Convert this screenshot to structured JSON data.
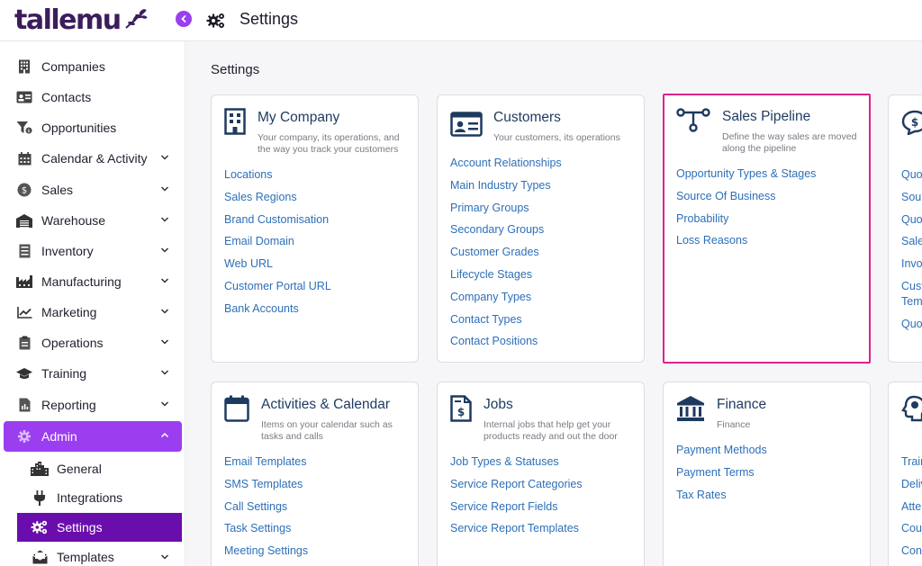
{
  "app": {
    "logo_text": "tallemu",
    "page_title": "Settings"
  },
  "colors": {
    "accent": "#9b3ef0",
    "active_sub": "#6a0dad",
    "link": "#2d6fb8",
    "highlight": "#e0218a",
    "title": "#1e3a5f"
  },
  "sidebar": {
    "items": [
      {
        "label": "Companies",
        "icon": "building-icon"
      },
      {
        "label": "Contacts",
        "icon": "contact-card-icon"
      },
      {
        "label": "Opportunities",
        "icon": "funnel-icon"
      },
      {
        "label": "Calendar & Activity",
        "icon": "calendar-icon"
      },
      {
        "label": "Sales",
        "icon": "dollar-coin-icon"
      },
      {
        "label": "Warehouse",
        "icon": "warehouse-icon"
      },
      {
        "label": "Inventory",
        "icon": "inventory-icon"
      },
      {
        "label": "Manufacturing",
        "icon": "factory-icon"
      },
      {
        "label": "Marketing",
        "icon": "trend-chart-icon"
      },
      {
        "label": "Operations",
        "icon": "clipboard-icon"
      },
      {
        "label": "Training",
        "icon": "graduation-cap-icon"
      },
      {
        "label": "Reporting",
        "icon": "report-icon"
      },
      {
        "label": "Admin",
        "icon": "gear-icon"
      }
    ],
    "sub_items": [
      {
        "label": "General",
        "icon": "city-icon"
      },
      {
        "label": "Integrations",
        "icon": "plug-icon"
      },
      {
        "label": "Settings",
        "icon": "gears-icon"
      },
      {
        "label": "Templates",
        "icon": "envelope-open-icon"
      }
    ]
  },
  "main": {
    "section_title": "Settings",
    "cards": [
      {
        "title": "My Company",
        "desc": "Your company, its operations, and the way you track your customers",
        "links": [
          "Locations",
          "Sales Regions",
          "Brand Customisation",
          "Email Domain",
          "Web URL",
          "Customer Portal URL",
          "Bank Accounts"
        ]
      },
      {
        "title": "Customers",
        "desc": "Your customers, its operations",
        "links": [
          "Account Relationships",
          "Main Industry Types",
          "Primary Groups",
          "Secondary Groups",
          "Customer Grades",
          "Lifecycle Stages",
          "Company Types",
          "Contact Types",
          "Contact Positions"
        ]
      },
      {
        "title": "Sales Pipeline",
        "desc": "Define the way sales are moved along the pipeline",
        "links": [
          "Opportunity Types & Stages",
          "Source Of Business",
          "Probability",
          "Loss Reasons"
        ]
      },
      {
        "title": "",
        "desc": "",
        "links": [
          "Quo",
          "Sour",
          "Quo",
          "Sales",
          "Invo",
          "Cust",
          "Tem",
          "Quo"
        ]
      },
      {
        "title": "Activities & Calendar",
        "desc": "Items on your calendar such as tasks and calls",
        "links": [
          "Email Templates",
          "SMS Templates",
          "Call Settings",
          "Task Settings",
          "Meeting Settings"
        ]
      },
      {
        "title": "Jobs",
        "desc": "Internal jobs that help get your products ready and out the door",
        "links": [
          "Job Types & Statuses",
          "Service Report Categories",
          "Service Report Fields",
          "Service Report Templates"
        ]
      },
      {
        "title": "Finance",
        "desc": "Finance",
        "links": [
          "Payment Methods",
          "Payment Terms",
          "Tax Rates"
        ]
      },
      {
        "title": "",
        "desc": "",
        "links": [
          "Trair",
          "Deliv",
          "Atte",
          "Cour",
          "Cont"
        ]
      }
    ]
  }
}
